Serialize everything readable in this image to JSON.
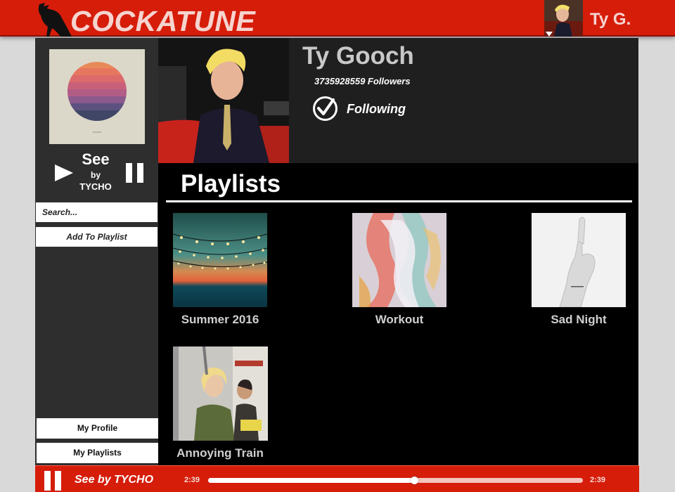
{
  "app": {
    "name": "COCKATUNE",
    "accent": "#d61d0a"
  },
  "user": {
    "short_name": "Ty G."
  },
  "now_playing": {
    "title": "See",
    "by": "by",
    "artist": "TYCHO"
  },
  "sidebar": {
    "search_placeholder": "Search...",
    "add_to_playlist": "Add To Playlist",
    "my_profile": "My Profile",
    "my_playlists": "My Playlists"
  },
  "profile": {
    "name": "Ty Gooch",
    "followers": "3735928559 Followers",
    "follow_status": "Following"
  },
  "playlists": {
    "heading": "Playlists",
    "items": [
      {
        "label": "Summer 2016"
      },
      {
        "label": "Workout"
      },
      {
        "label": "Sad Night"
      },
      {
        "label": "Annoying Train"
      }
    ]
  },
  "player": {
    "track": "See by TYCHO",
    "elapsed": "2:39",
    "duration": "2:39",
    "progress": 0.55
  }
}
